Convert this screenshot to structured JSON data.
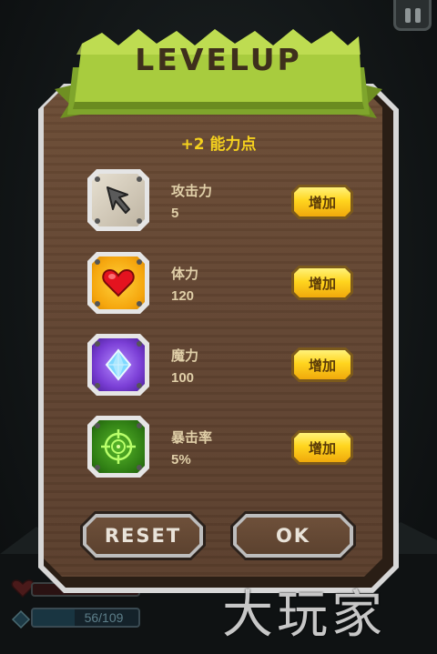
{
  "title": "LEVELUP",
  "points_label": "+2 能力点",
  "stats": [
    {
      "name": "攻击力",
      "value": "5",
      "icon": "arrow-cursor-icon"
    },
    {
      "name": "体力",
      "value": "120",
      "icon": "heart-icon"
    },
    {
      "name": "魔力",
      "value": "100",
      "icon": "diamond-gem-icon"
    },
    {
      "name": "暴击率",
      "value": "5%",
      "icon": "crosshair-target-icon"
    }
  ],
  "add_label": "增加",
  "buttons": {
    "reset": "RESET",
    "ok": "OK"
  },
  "hud": {
    "mana_text": "56/109"
  },
  "watermark": "大玩家",
  "colors": {
    "banner_green": "#9cc23a",
    "wood": "#614431",
    "points_yellow": "#f5d11e",
    "button_gold": "#ffd51e"
  }
}
